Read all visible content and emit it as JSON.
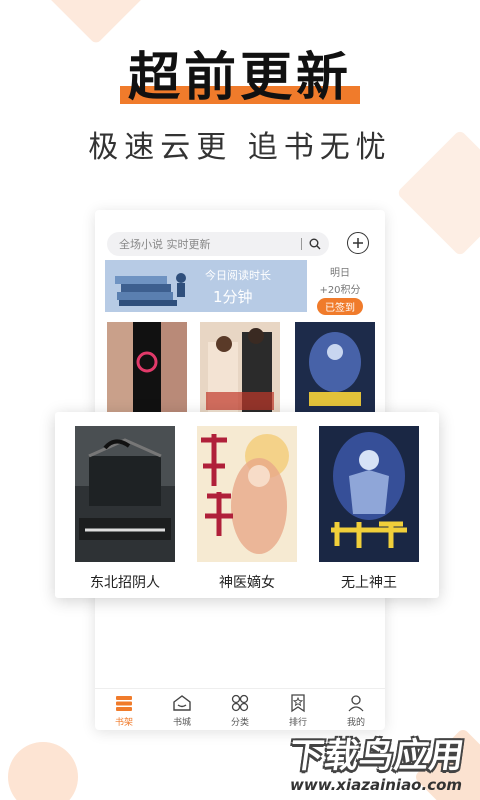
{
  "promo": {
    "headline": "超前更新",
    "subline": "极速云更  追书无忧"
  },
  "search": {
    "placeholder": "全场小说 实时更新"
  },
  "reading_banner": {
    "title": "今日阅读时长",
    "value": "1分钟"
  },
  "checkin": {
    "day": "明日",
    "points": "+20积分",
    "button": "已签到"
  },
  "popup_books": [
    {
      "title": "东北招阴人"
    },
    {
      "title": "神医嫡女"
    },
    {
      "title": "无上神王"
    }
  ],
  "tabbar": {
    "items": [
      {
        "label": "书架",
        "icon": "bookshelf-icon",
        "active": true
      },
      {
        "label": "书城",
        "icon": "bookstore-icon",
        "active": false
      },
      {
        "label": "分类",
        "icon": "category-icon",
        "active": false
      },
      {
        "label": "排行",
        "icon": "ranking-icon",
        "active": false
      },
      {
        "label": "我的",
        "icon": "profile-icon",
        "active": false
      }
    ]
  },
  "watermark": {
    "brand": "下载鸟应用",
    "url": "www.xiazainiao.com"
  },
  "colors": {
    "accent": "#f07b2b",
    "banner": "#b7cbe5"
  }
}
